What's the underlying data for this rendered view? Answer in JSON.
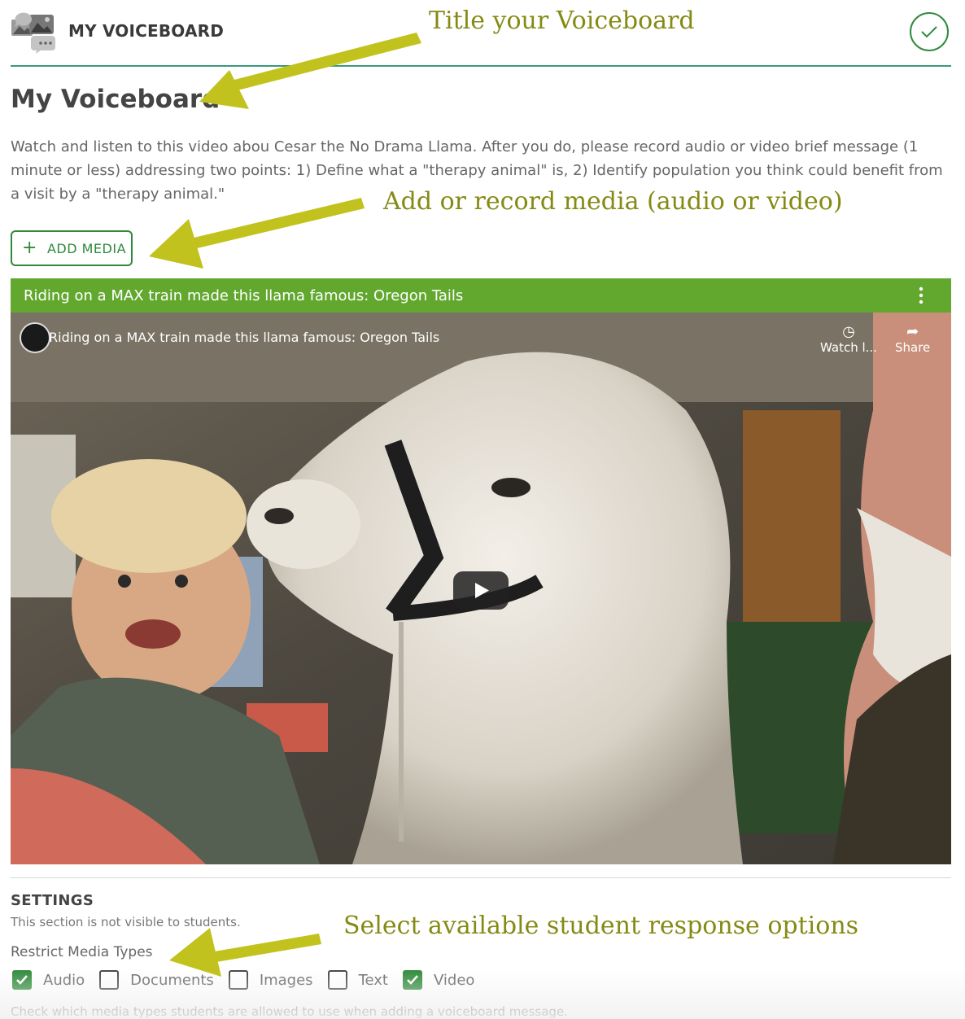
{
  "header": {
    "app_name": "MY VOICEBOARD",
    "logo_icon": "voiceboard-logo-icon",
    "done_icon": "checkmark-icon"
  },
  "board": {
    "title": "My Voiceboard",
    "description": "Watch and listen to this video abou Cesar the No Drama Llama. After you do, please record audio or video brief message (1 minute or less) addressing two points: 1) Define what a \"therapy animal\" is, 2) Identify  population you think could benefit from a visit by a \"therapy animal.\""
  },
  "add_media": {
    "label": "ADD MEDIA"
  },
  "media": {
    "bar_title": "Riding on a MAX train made this llama famous: Oregon Tails",
    "video_title": "Riding on a MAX train made this llama famous: Oregon Tails",
    "watch_later": "Watch l...",
    "share": "Share",
    "bar_color": "#62a82f"
  },
  "settings": {
    "heading": "SETTINGS",
    "note": "This section is not visible to students.",
    "restrict_label": "Restrict Media Types",
    "options": [
      {
        "label": "Audio",
        "checked": true
      },
      {
        "label": "Documents",
        "checked": false
      },
      {
        "label": "Images",
        "checked": false
      },
      {
        "label": "Text",
        "checked": false
      },
      {
        "label": "Video",
        "checked": true
      }
    ],
    "help": "Check which media types students are allowed to use when adding a voiceboard message."
  },
  "annotations": {
    "title_note": "Title your Voiceboard",
    "media_note": "Add or record media (audio or video)",
    "options_note": "Select available student response options",
    "color": "#858a14"
  },
  "colors": {
    "accent": "#2f8a3a",
    "rule": "#3a9a7a"
  }
}
